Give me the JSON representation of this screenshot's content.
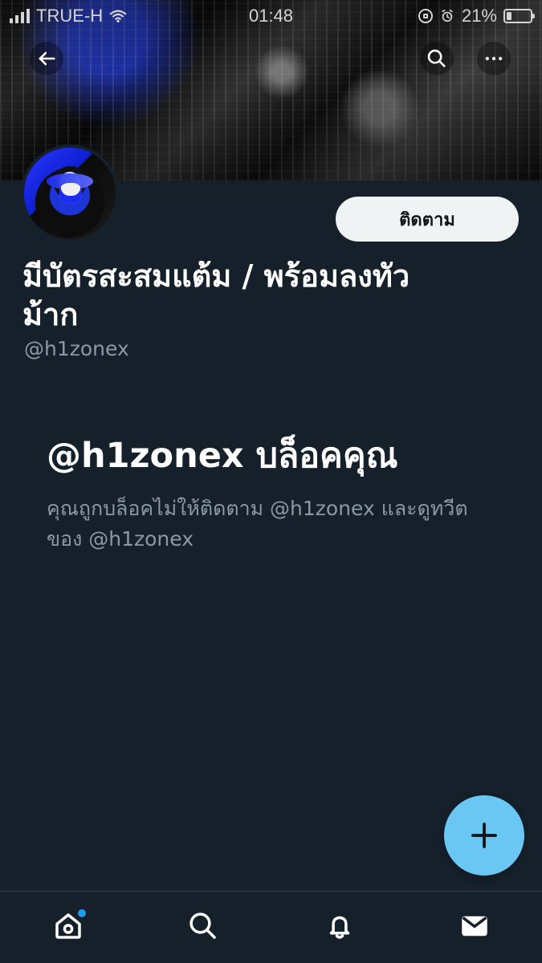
{
  "status_bar": {
    "carrier": "TRUE-H",
    "time": "01:48",
    "battery_percent": "21%",
    "battery_level": 0.21
  },
  "header": {
    "icons": {
      "back": "arrow-left-icon",
      "search": "search-icon",
      "more": "more-icon"
    }
  },
  "profile": {
    "name": "มีบัตรสะสมแต้ม / พร้อมลงทัวม้าก",
    "handle": "@h1zonex",
    "follow_label": "ติดตาม"
  },
  "blocked_notice": {
    "title": "@h1zonex บล็อคคุณ",
    "message": "คุณถูกบล็อคไม่ให้ติดตาม @h1zonex และดูทวีตของ @h1zonex"
  },
  "bottom_nav": {
    "items": [
      {
        "label": "home",
        "icon": "home-icon"
      },
      {
        "label": "search",
        "icon": "search-icon"
      },
      {
        "label": "notifications",
        "icon": "bell-icon"
      },
      {
        "label": "messages",
        "icon": "mail-icon"
      }
    ]
  },
  "colors": {
    "background": "#15202b",
    "primary_text": "#ffffff",
    "secondary_text": "#8b98a5",
    "follow_button": "#eff3f4",
    "fab": "#6ac7f3",
    "home_notification_dot": "#1d9bf0"
  }
}
